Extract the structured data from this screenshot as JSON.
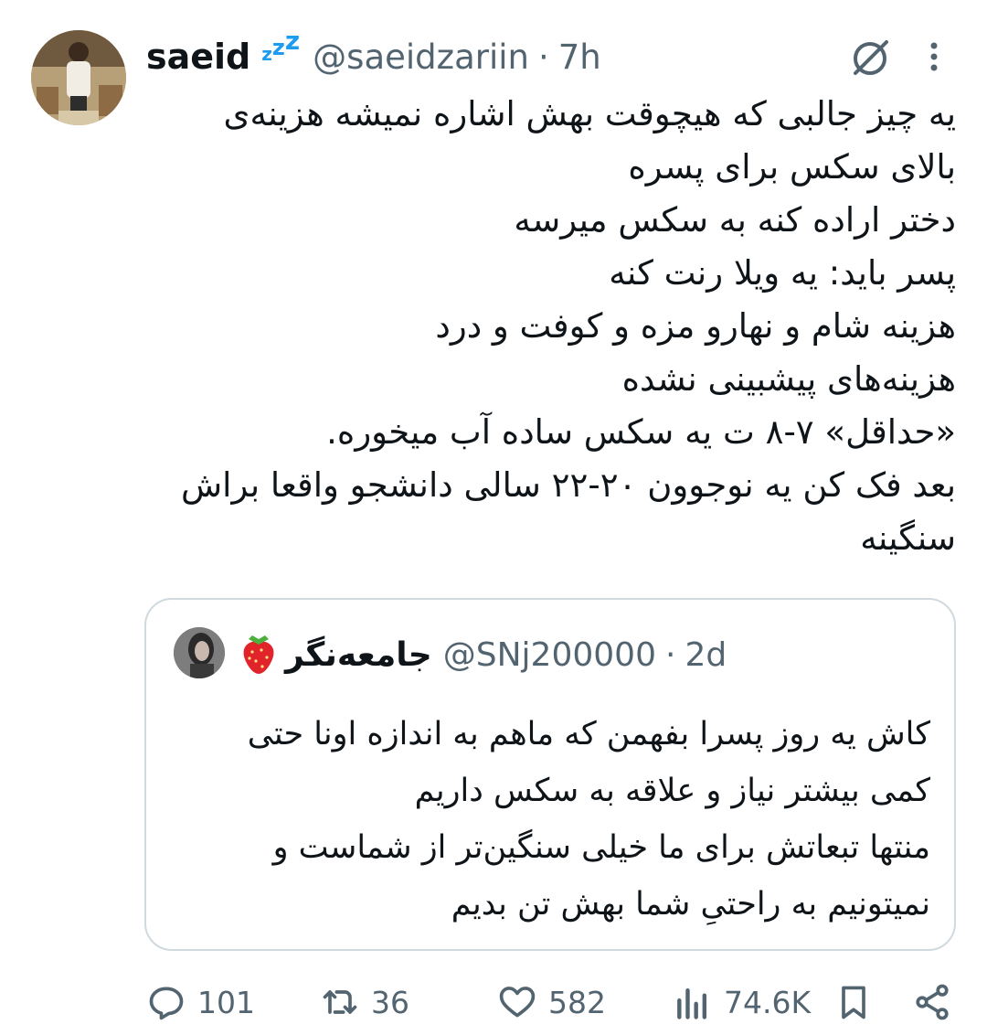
{
  "tweet": {
    "author_name": "saeid",
    "author_badge": "zzz",
    "handle": "@saeidzariin",
    "separator": "·",
    "time": "7h",
    "text_lines": [
      "یه چیز جالبی که هیچوقت بهش اشاره نمیشه هزینه‌ی",
      "بالای سکس برای پسره",
      "دختر اراده کنه به سکس میرسه",
      "پسر باید: یه ویلا رنت کنه",
      "هزینه شام و نهارو مزه و کوفت و درد",
      "هزینه‌های پیشبینی نشده",
      "«حداقل» ۷-۸ ت یه سکس ساده آب میخوره.",
      "بعد فک کن یه نوجوون ۲۰-۲۲ سالی دانشجو واقعا براش",
      "سنگینه"
    ]
  },
  "quote": {
    "author_name": "جامعه‌نگر",
    "handle": "@SNj200000",
    "separator": "·",
    "time": "2d",
    "text_lines": [
      "کاش یه روز پسرا بفهمن که ماهم به اندازه اونا حتی",
      "کمی بیشتر نیاز و علاقه به سکس داریم",
      "منتها تبعاتش برای ما خیلی سنگین‌تر از شماست و",
      "نمیتونیم به راحتیِ شما بهش تن بدیم"
    ]
  },
  "actions": {
    "replies": "101",
    "retweets": "36",
    "likes": "582",
    "views": "74.6K"
  },
  "icons": {
    "grok": "grok-icon",
    "more": "more-vertical-icon",
    "reply": "reply-icon",
    "retweet": "retweet-icon",
    "like": "heart-icon",
    "views": "views-icon",
    "bookmark": "bookmark-icon",
    "share": "share-icon"
  },
  "colors": {
    "accent": "#1d9bf0",
    "text": "#0f1419",
    "muted": "#536471",
    "border": "#cfd9de"
  }
}
